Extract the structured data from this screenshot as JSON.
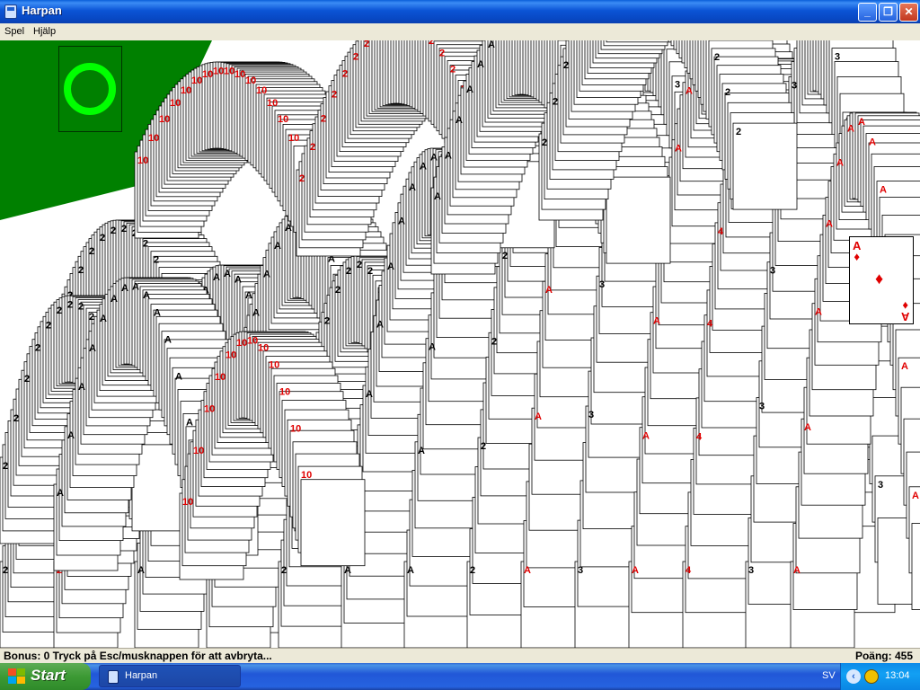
{
  "window": {
    "title": "Harpan",
    "controls": [
      "minimize",
      "maximize",
      "close"
    ]
  },
  "menu": {
    "items": [
      {
        "label": "Spel"
      },
      {
        "label": "Hjälp"
      }
    ]
  },
  "game": {
    "felt_color": "#008000",
    "deck_ring_color": "#00ff00",
    "card_red": "#e00000",
    "card_black": "#000000",
    "visible_ranks": [
      "10",
      "2",
      "A",
      "3",
      "4"
    ],
    "top_card": {
      "rank": "A",
      "suit": "diamonds",
      "suit_glyph": "♦"
    }
  },
  "status": {
    "message": "Bonus: 0  Tryck på Esc/musknappen för att avbryta...",
    "score": "Poäng: 455"
  },
  "taskbar": {
    "start_label": "Start",
    "tasks": [
      {
        "label": "Harpan"
      }
    ],
    "language": "SV",
    "clock": "13:04"
  }
}
